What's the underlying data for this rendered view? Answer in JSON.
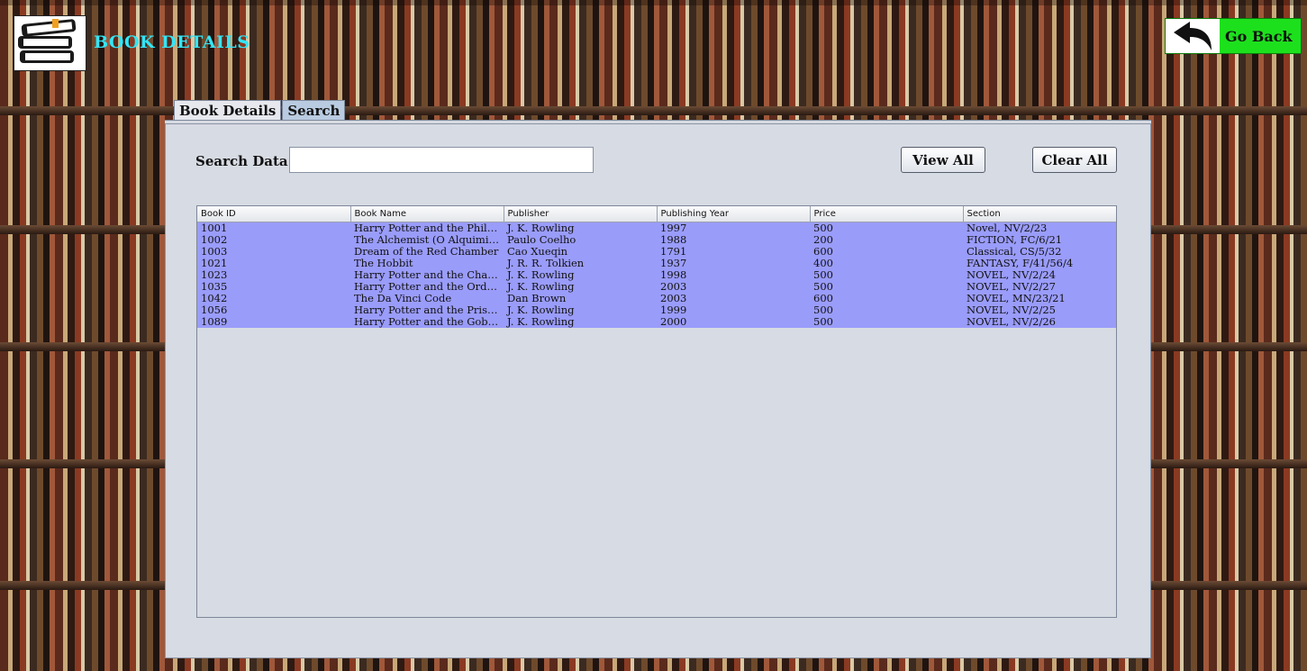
{
  "header": {
    "title": "BOOK DETAILS",
    "go_back_label": "Go Back"
  },
  "tabs": [
    {
      "label": "Book Details",
      "active": false
    },
    {
      "label": "Search",
      "active": true
    }
  ],
  "search": {
    "label": "Search Data",
    "value": "",
    "view_all_label": "View All",
    "clear_all_label": "Clear All"
  },
  "table": {
    "columns": [
      "Book ID",
      "Book Name",
      "Publisher",
      "Publishing Year",
      "Price",
      "Section"
    ],
    "rows": [
      [
        "1001",
        "Harry Potter and the Philos...",
        "J. K. Rowling",
        "1997",
        "500",
        "Novel, NV/2/23"
      ],
      [
        "1002",
        "The Alchemist (O Alquimis...",
        "Paulo Coelho",
        "1988",
        "200",
        "FICTION, FC/6/21"
      ],
      [
        "1003",
        "Dream of the Red Chamber",
        "Cao Xueqin",
        "1791",
        "600",
        "Classical, CS/5/32"
      ],
      [
        "1021",
        "The Hobbit",
        "J. R. R. Tolkien",
        "1937",
        "400",
        "FANTASY, F/41/56/4"
      ],
      [
        "1023",
        "Harry Potter and the Cham...",
        "J. K. Rowling",
        "1998",
        "500",
        "NOVEL, NV/2/24"
      ],
      [
        "1035",
        "Harry Potter and the Order...",
        "J. K. Rowling",
        "2003",
        "500",
        "NOVEL, NV/2/27"
      ],
      [
        "1042",
        "The Da Vinci Code",
        "Dan Brown",
        "2003",
        "600",
        "NOVEL, MN/23/21"
      ],
      [
        "1056",
        "Harry Potter and the Priso...",
        "J. K. Rowling",
        "1999",
        "500",
        "NOVEL, NV/2/25"
      ],
      [
        "1089",
        "Harry Potter and the Goble...",
        "J. K. Rowling",
        "2000",
        "500",
        "NOVEL, NV/2/26"
      ]
    ]
  },
  "colors": {
    "title": "#33e5f5",
    "go_back_bg": "#1de01d",
    "row_selected": "#9a9cfa",
    "panel": "#d7dbe3"
  },
  "icons": {
    "logo": "books-stack-icon",
    "go_back": "back-arrow-icon"
  }
}
